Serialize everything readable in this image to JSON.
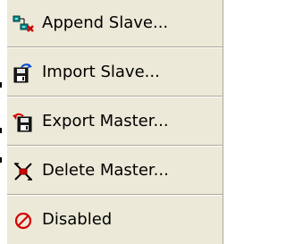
{
  "menu": {
    "items": [
      {
        "label": "Append Slave...",
        "icon": "append-slave-icon"
      },
      {
        "label": "Import Slave...",
        "icon": "import-slave-icon"
      },
      {
        "label": "Export Master...",
        "icon": "export-master-icon"
      },
      {
        "label": "Delete Master...",
        "icon": "delete-master-icon"
      },
      {
        "label": "Disabled",
        "icon": "disabled-icon"
      }
    ]
  },
  "colors": {
    "menu_background": "#ece9d8",
    "separator": "#aca899",
    "text": "#000000",
    "accent_red": "#d40000",
    "accent_blue": "#0a4fd1",
    "accent_teal": "#0a8a8a"
  }
}
